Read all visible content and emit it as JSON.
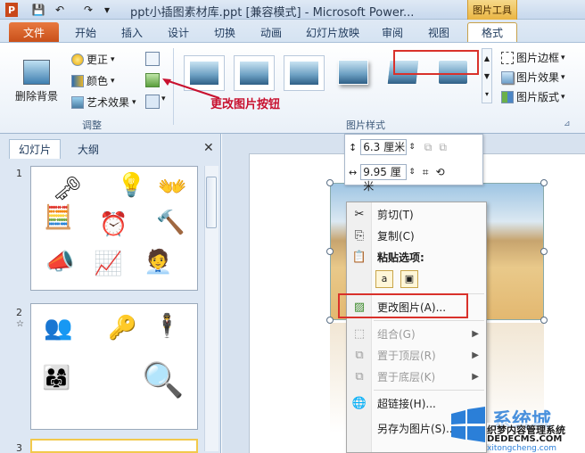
{
  "titlebar": {
    "app_title": "ppt小插图素材库.ppt [兼容模式] - Microsoft Power...",
    "context_header": "图片工具",
    "qat": [
      "P",
      "💾",
      "↶",
      "↷",
      "▾"
    ]
  },
  "tabs": [
    "文件",
    "开始",
    "插入",
    "设计",
    "切换",
    "动画",
    "幻灯片放映",
    "审阅",
    "视图",
    "格式"
  ],
  "ribbon": {
    "remove_bg": "删除背景",
    "corrections": "更正",
    "color": "颜色",
    "artistic_effects": "艺术效果",
    "adjust_group": "调整",
    "styles_group": "图片样式",
    "picture_border": "图片边框",
    "picture_effects": "图片效果",
    "picture_layout": "图片版式",
    "dropdown": "▾",
    "more": "▾"
  },
  "annotation": {
    "change_picture_button": "更改图片按钮"
  },
  "panel": {
    "tab_slides": "幻灯片",
    "tab_outline": "大纲",
    "close": "✕",
    "slide_numbers": [
      "1",
      "2",
      "3"
    ],
    "slide2_marker": "☆"
  },
  "minibar": {
    "height_value": "6.3 厘米",
    "width_value": "9.95 厘米"
  },
  "context_menu": {
    "cut": "剪切(T)",
    "copy": "复制(C)",
    "paste_options": "粘贴选项:",
    "change_picture": "更改图片(A)...",
    "group": "组合(G)",
    "bring_front": "置于顶层(R)",
    "send_back": "置于底层(K)",
    "hyperlink": "超链接(H)...",
    "save_as_picture": "另存为图片(S)...",
    "submenu_arrow": "▶"
  },
  "watermark": {
    "brand": "系统城",
    "line1": "织梦内容管理系统",
    "line2": "DEDECMS.COM",
    "url": "xitongcheng.com"
  }
}
